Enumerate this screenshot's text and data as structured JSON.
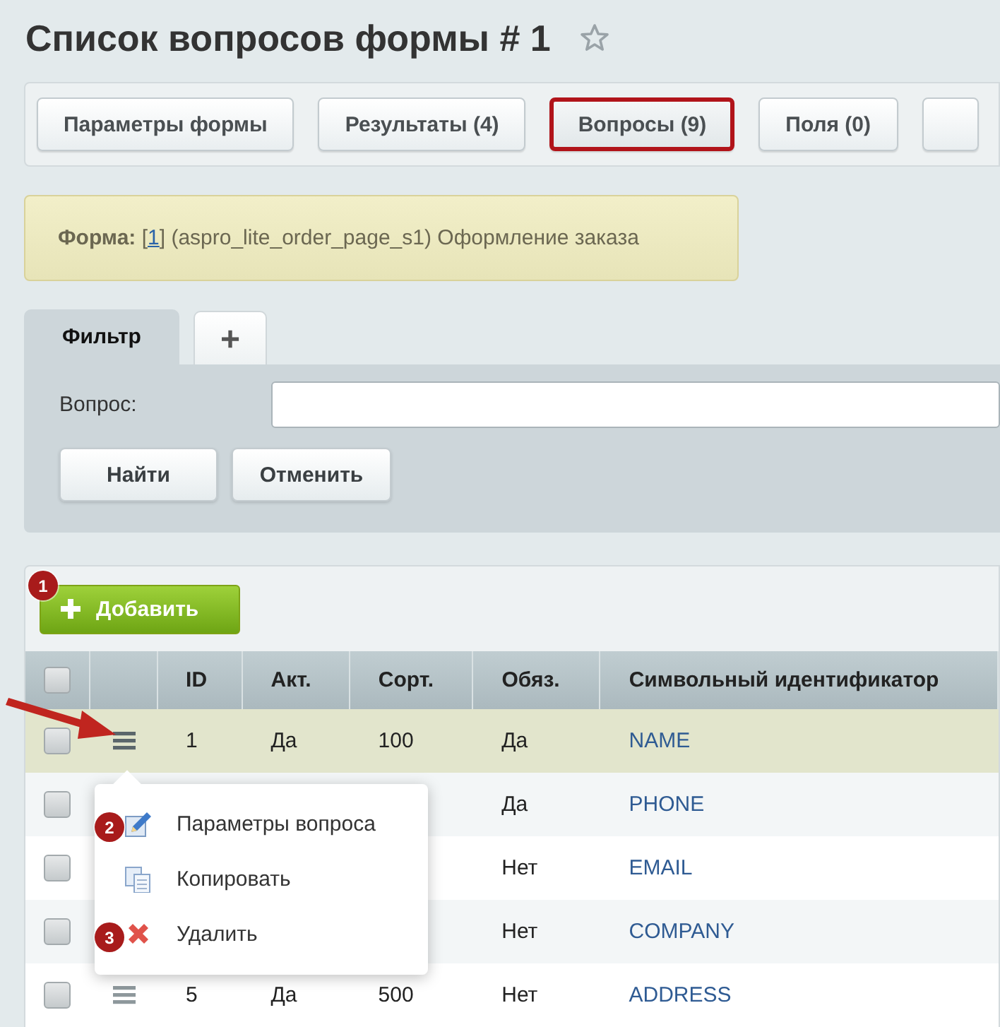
{
  "title": "Список вопросов формы # 1",
  "favorite": false,
  "toolbar": [
    {
      "label": "Параметры формы",
      "selected": false
    },
    {
      "label": "Результаты (4)",
      "selected": false
    },
    {
      "label": "Вопросы (9)",
      "selected": true
    },
    {
      "label": "Поля (0)",
      "selected": false
    }
  ],
  "form_note": {
    "before": "**Форма:** [",
    "link": "1",
    "after": "] (aspro_lite_order_page_s1) Оформление заказа"
  },
  "filter": {
    "tabs": [
      {
        "label": "Фильтр",
        "selected": true
      },
      {
        "label": "+",
        "selected": false
      }
    ],
    "field_label": "Вопрос:",
    "buttons": [
      "Найти",
      "Отменить"
    ]
  },
  "add_button": {
    "label": "Добавить",
    "badge": "1"
  },
  "table": {
    "columns": [
      "ID",
      "Акт.",
      "Сорт.",
      "Обяз.",
      "Символьный идентификатор"
    ],
    "header_checked": false,
    "rows": [
      {
        "checked": false,
        "selected": true,
        "id": "1",
        "active": "Да",
        "sort": "100",
        "required": "Да",
        "code": "NAME"
      },
      {
        "checked": false,
        "selected": false,
        "required": "Да",
        "code": "PHONE"
      },
      {
        "checked": false,
        "selected": false,
        "required": "Нет",
        "code": "EMAIL"
      },
      {
        "checked": false,
        "selected": false,
        "required": "Нет",
        "code": "COMPANY"
      },
      {
        "checked": false,
        "selected": false,
        "id": "5",
        "active": "Да",
        "sort": "500",
        "required": "Нет",
        "code": "ADDRESS"
      }
    ]
  },
  "context_menu": {
    "items": [
      {
        "kind": "edit",
        "label": "Параметры вопроса",
        "badge": "2"
      },
      {
        "kind": "copy",
        "label": "Копировать"
      },
      {
        "kind": "delete",
        "label": "Удалить",
        "badge": "3"
      }
    ]
  }
}
